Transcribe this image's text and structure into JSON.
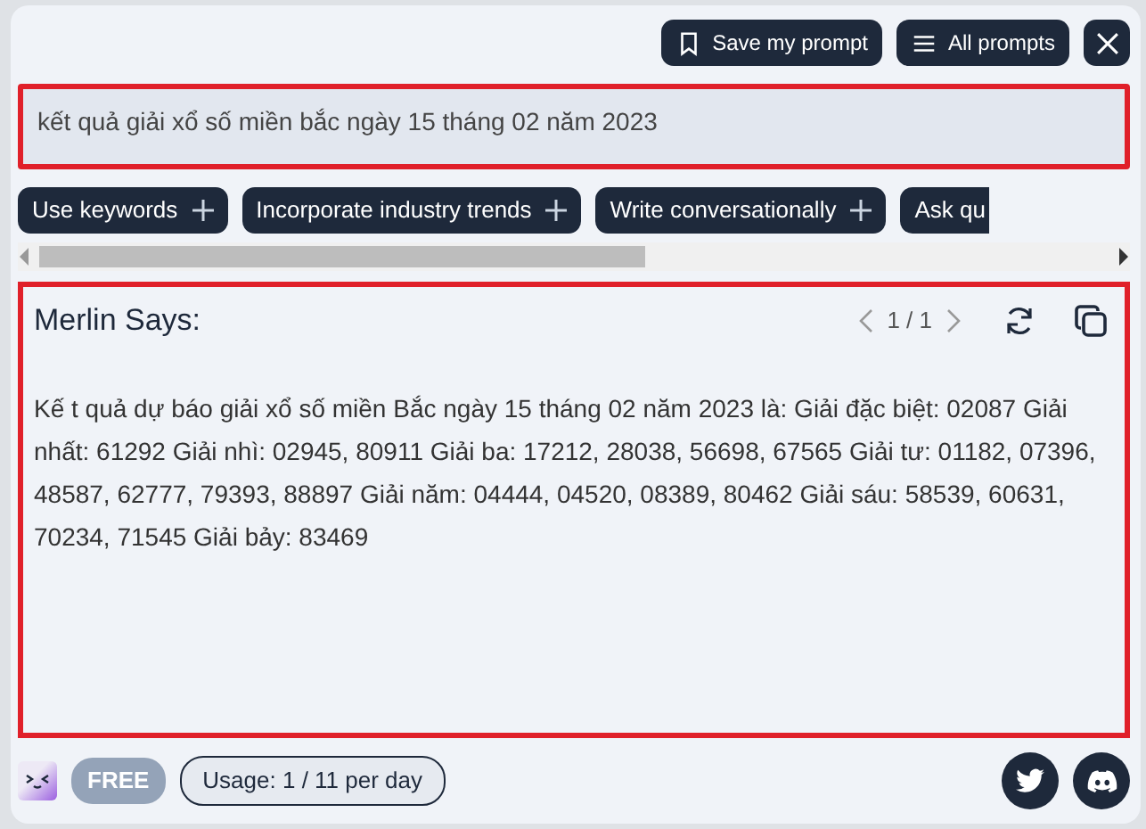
{
  "header_buttons": [
    {
      "label": "Save my prompt"
    },
    {
      "label": "All prompts"
    }
  ],
  "prompt": {
    "value": "kết quả giải xổ số miền bắc ngày 15 tháng 02 năm 2023"
  },
  "suggestions": [
    {
      "label": "Use keywords"
    },
    {
      "label": "Incorporate industry trends"
    },
    {
      "label": "Write conversationally"
    },
    {
      "label": "Ask qu"
    }
  ],
  "response": {
    "title": "Merlin Says:",
    "pager": "1 / 1",
    "text": "Kế t quả dự báo giải xổ số miền Bắc ngày 15 tháng 02 năm 2023 là: Giải đặc biệt: 02087 Giải nhất: 61292 Giải nhì: 02945, 80911 Giải ba: 17212, 28038, 56698, 67565 Giải tư: 01182, 07396, 48587, 62777, 79393, 88897 Giải năm: 04444, 04520, 08389, 80462 Giải sáu: 58539, 60631, 70234, 71545 Giải bảy: 83469"
  },
  "footer": {
    "plan": "FREE",
    "usage": "Usage: 1 / 11 per day"
  }
}
